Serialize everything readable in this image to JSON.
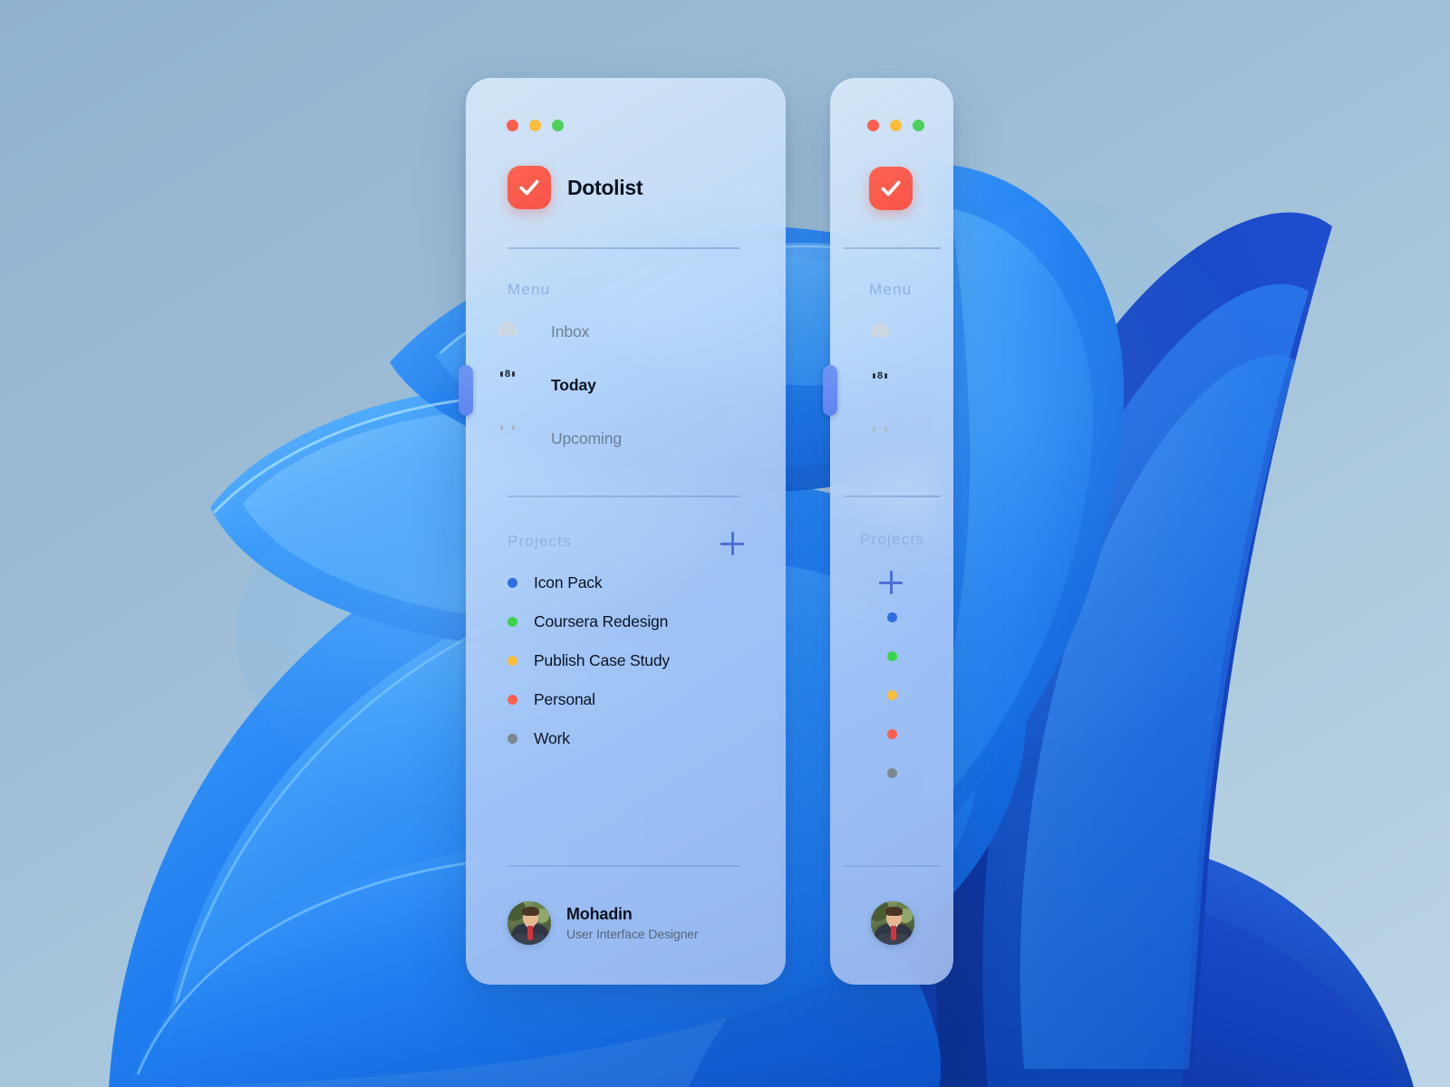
{
  "window_controls": [
    {
      "name": "close",
      "color": "#fb5f4e"
    },
    {
      "name": "minimize",
      "color": "#fbbd3c"
    },
    {
      "name": "maximize",
      "color": "#4ed05a"
    }
  ],
  "app": {
    "name": "Dotolist",
    "icon": "check-icon",
    "icon_color": "#fb5d4e"
  },
  "sections": {
    "menu_label": "Menu",
    "projects_label": "Projects",
    "add_project_label": "+"
  },
  "menu": {
    "items": [
      {
        "label": "Inbox",
        "icon": "inbox-icon",
        "active": false
      },
      {
        "label": "Today",
        "icon": "calendar-day-icon",
        "active": true
      },
      {
        "label": "Upcoming",
        "icon": "calendar-upcoming-icon",
        "active": false
      }
    ]
  },
  "projects": {
    "items": [
      {
        "label": "Icon Pack",
        "color": "#2f6ee0"
      },
      {
        "label": "Coursera Redesign",
        "color": "#3bd44a"
      },
      {
        "label": "Publish Case Study",
        "color": "#fbbd3c"
      },
      {
        "label": "Personal",
        "color": "#fb5f4e"
      },
      {
        "label": "Work",
        "color": "#7d8791"
      }
    ]
  },
  "user": {
    "name": "Mohadin",
    "role": "User Interface Designer",
    "avatar": "user-avatar"
  },
  "theme": {
    "accent": "#4c6fd8",
    "section_label_color": "#8cb3e2",
    "text_primary": "#0d1321",
    "text_muted": "#6d7f94"
  }
}
